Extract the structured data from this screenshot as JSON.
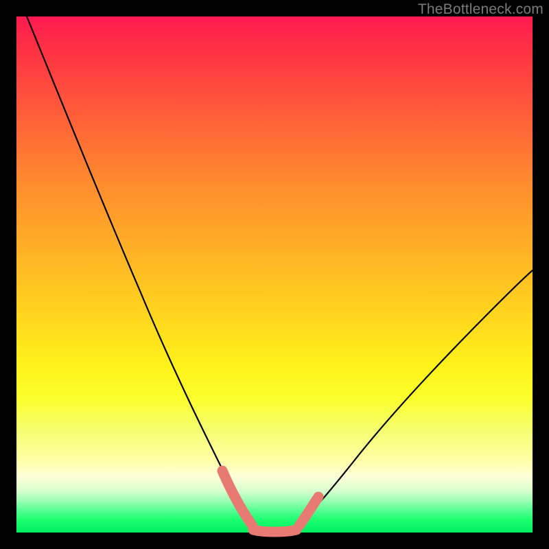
{
  "watermark": "TheBottleneck.com",
  "chart_data": {
    "type": "line",
    "title": "",
    "xlabel": "",
    "ylabel": "",
    "xlim": [
      0,
      100
    ],
    "ylim": [
      0,
      100
    ],
    "grid": false,
    "background": "rainbow-vertical-gradient",
    "series": [
      {
        "name": "left-curve",
        "x": [
          2,
          8,
          14,
          20,
          26,
          31,
          36,
          40,
          43,
          45,
          46
        ],
        "values": [
          100,
          86,
          72,
          58,
          44,
          31,
          20,
          11,
          5,
          2,
          1
        ]
      },
      {
        "name": "right-curve",
        "x": [
          54,
          57,
          62,
          68,
          75,
          83,
          92,
          100
        ],
        "values": [
          1,
          3,
          7,
          13,
          21,
          30,
          40,
          49
        ]
      },
      {
        "name": "flat-bottom",
        "x": [
          45,
          48,
          51,
          54
        ],
        "values": [
          1,
          0,
          0,
          1
        ]
      },
      {
        "name": "red-overlay-left",
        "x": [
          40,
          42,
          44,
          46
        ],
        "values": [
          12,
          7,
          3,
          1
        ]
      },
      {
        "name": "red-overlay-bottom",
        "x": [
          45,
          47,
          49,
          51,
          53,
          55
        ],
        "values": [
          1,
          0,
          0,
          0,
          0,
          1
        ]
      },
      {
        "name": "red-overlay-right",
        "x": [
          54,
          56,
          58
        ],
        "values": [
          1,
          4,
          7
        ]
      }
    ],
    "annotations": []
  }
}
